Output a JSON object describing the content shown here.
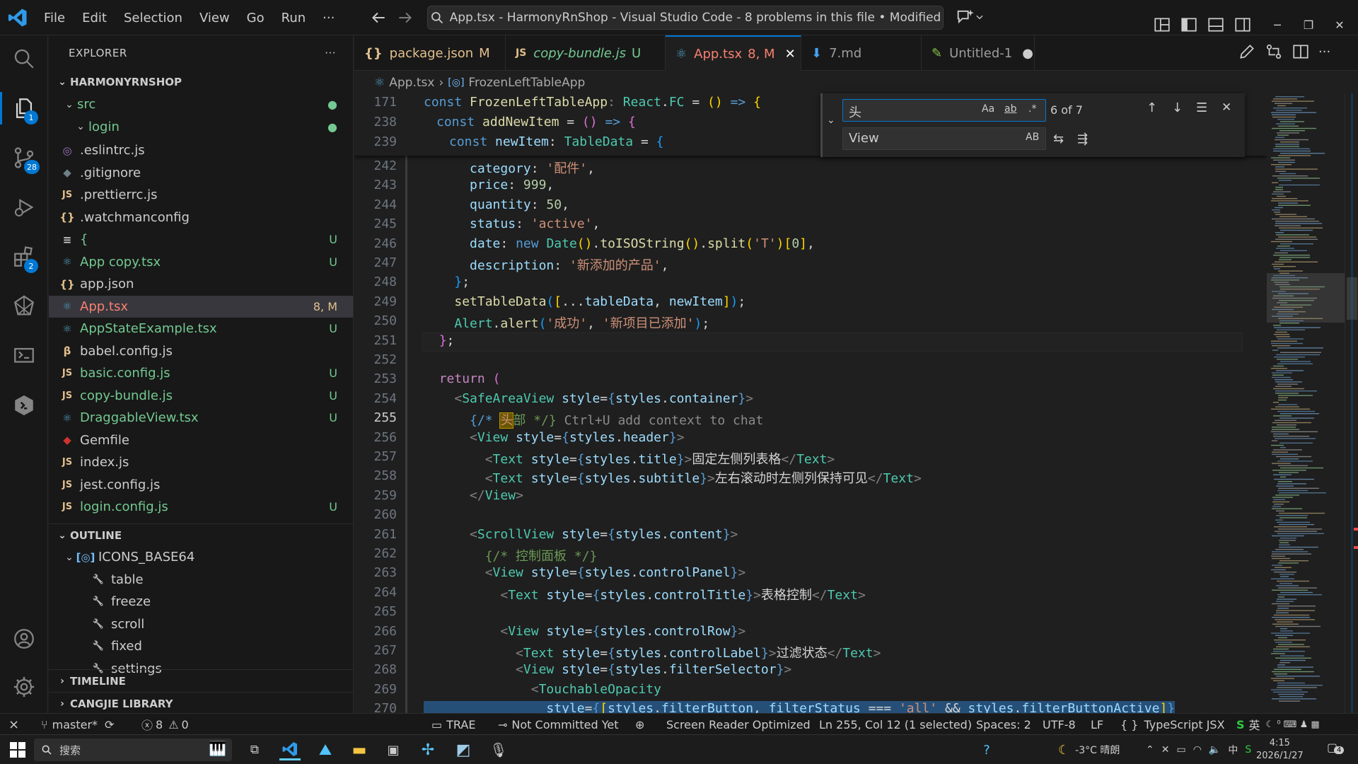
{
  "menu": [
    "File",
    "Edit",
    "Selection",
    "View",
    "Go",
    "Run",
    "···"
  ],
  "command_center": "App.tsx - HarmonyRnShop - Visual Studio Code - 8 problems in this file • Modified",
  "activity_badges": {
    "explorer": "1",
    "scm": "28",
    "extensions": "2"
  },
  "sidebar": {
    "title": "EXPLORER",
    "more": "···",
    "project": "HARMONYRNSHOP",
    "folders": [
      {
        "name": "src"
      },
      {
        "name": "login"
      }
    ],
    "files": [
      {
        "icon": "◎",
        "name": ".eslintrc.js",
        "status": ""
      },
      {
        "icon": "◆",
        "name": ".gitignore",
        "status": ""
      },
      {
        "icon": "JS",
        "name": ".prettierrc.js",
        "status": ""
      },
      {
        "icon": "{}",
        "name": ".watchmanconfig",
        "status": ""
      },
      {
        "icon": "≡",
        "name": "{",
        "status": "U"
      },
      {
        "icon": "⚛",
        "name": "App copy.tsx",
        "status": "U"
      },
      {
        "icon": "{}",
        "name": "app.json",
        "status": ""
      },
      {
        "icon": "⚛",
        "name": "App.tsx",
        "status": "8, M"
      },
      {
        "icon": "⚛",
        "name": "AppStateExample.tsx",
        "status": "U"
      },
      {
        "icon": "β",
        "name": "babel.config.js",
        "status": ""
      },
      {
        "icon": "JS",
        "name": "basic.config.js",
        "status": "U"
      },
      {
        "icon": "JS",
        "name": "copy-bundle.js",
        "status": "U"
      },
      {
        "icon": "⚛",
        "name": "DraggableView.tsx",
        "status": "U"
      },
      {
        "icon": "◆",
        "name": "Gemfile",
        "status": ""
      },
      {
        "icon": "JS",
        "name": "index.js",
        "status": ""
      },
      {
        "icon": "JS",
        "name": "jest.config.js",
        "status": ""
      },
      {
        "icon": "JS",
        "name": "login.config.js",
        "status": "U"
      }
    ],
    "outline_title": "OUTLINE",
    "outline_root": "ICONS_BASE64",
    "outline_items": [
      "table",
      "freeze",
      "scroll",
      "fixed",
      "settings"
    ],
    "timeline_title": "TIMELINE",
    "cangjie_title": "CANGJIE LIBRARY"
  },
  "tabs": [
    {
      "icon": "{}",
      "label": "package.json",
      "status": "M"
    },
    {
      "icon": "JS",
      "label": "copy-bundle.js",
      "status": "U"
    },
    {
      "icon": "⚛",
      "label": "App.tsx",
      "status": "8, M"
    },
    {
      "icon": "⬇",
      "label": "7.md",
      "status": ""
    },
    {
      "icon": "✎",
      "label": "Untitled-1",
      "status": "●"
    }
  ],
  "breadcrumb": {
    "file": "App.tsx",
    "symbol": "FrozenLeftTableApp"
  },
  "find": {
    "query": "头",
    "count": "6 of 7",
    "replace": "View",
    "opt_case": "Aa",
    "opt_word": "ab",
    "opt_regex": ".*",
    "opt_preserve": "AB"
  },
  "sticky_lines": [
    "171",
    "238",
    "239"
  ],
  "line_numbers": [
    "242",
    "243",
    "244",
    "245",
    "246",
    "247",
    "248",
    "249",
    "250",
    "251",
    "252",
    "253",
    "254",
    "255",
    "256",
    "257",
    "258",
    "259",
    "260",
    "261",
    "262",
    "263",
    "264",
    "265",
    "266",
    "267",
    "268",
    "269",
    "270"
  ],
  "code_strings": {
    "cat_val": "'配件'",
    "status_val": "'active'",
    "t_split": "'T'",
    "desc_val": "'新添加的产品'",
    "alert1": "'成功'",
    "alert2": "'新项目已添加'",
    "cm_head_a": "{/* ",
    "cm_head_b": "头",
    "cm_head_c": "部 */}",
    "hint": " Ctrl+U add context to chat",
    "title_txt": "固定左侧列表格",
    "subtitle_txt": "左右滚动时左侧列保持可见",
    "cm_panel": "{/* 控制面板 */}",
    "ctrl_title": "表格控制",
    "filter_label": "过滤状态",
    "all": "'all'",
    "price": "999",
    "qty": "50",
    "zero": "0"
  },
  "status": {
    "branch": "master*",
    "errors": "8",
    "warnings": "0",
    "trae": "TRAE",
    "commit": "Not Committed Yet",
    "reader": "Screen Reader Optimized",
    "position": "Ln 255, Col 12 (1 selected)",
    "spaces": "Spaces: 2",
    "encoding": "UTF-8",
    "eol": "LF",
    "language": "TypeScript JSX",
    "ime": "英"
  },
  "taskbar": {
    "search": "搜索",
    "weather": "-3°C  晴朗",
    "time": "4:15",
    "date": "2026/1/27",
    "notifications": "4"
  },
  "colors": {
    "accent": "#0078d4",
    "untracked": "#73c991",
    "modified": "#e2c08d"
  }
}
